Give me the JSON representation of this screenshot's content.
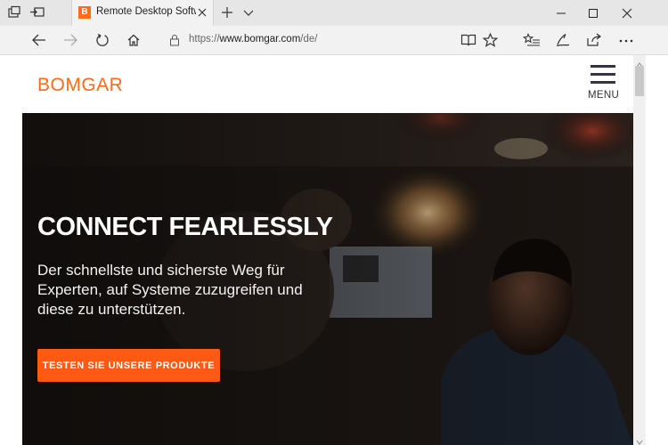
{
  "browser": {
    "tab_title": "Remote Desktop Software",
    "tab_favicon": "B",
    "url_scheme": "https://",
    "url_host": "www.bomgar.com",
    "url_path": "/de/"
  },
  "site": {
    "logo": "BOMGAR",
    "menu_label": "MENU"
  },
  "hero": {
    "title": "CONNECT FEARLESSLY",
    "text": "Der schnellste und sicherste Weg für Experten, auf Systeme zuzugreifen und diese zu unterstützen.",
    "cta_label": "TESTEN SIE UNSERE PRODUKTE"
  },
  "colors": {
    "brand_orange": "#ff6b1a",
    "cta_orange": "#ff5a14",
    "chrome_bg": "#e6e6e6"
  }
}
